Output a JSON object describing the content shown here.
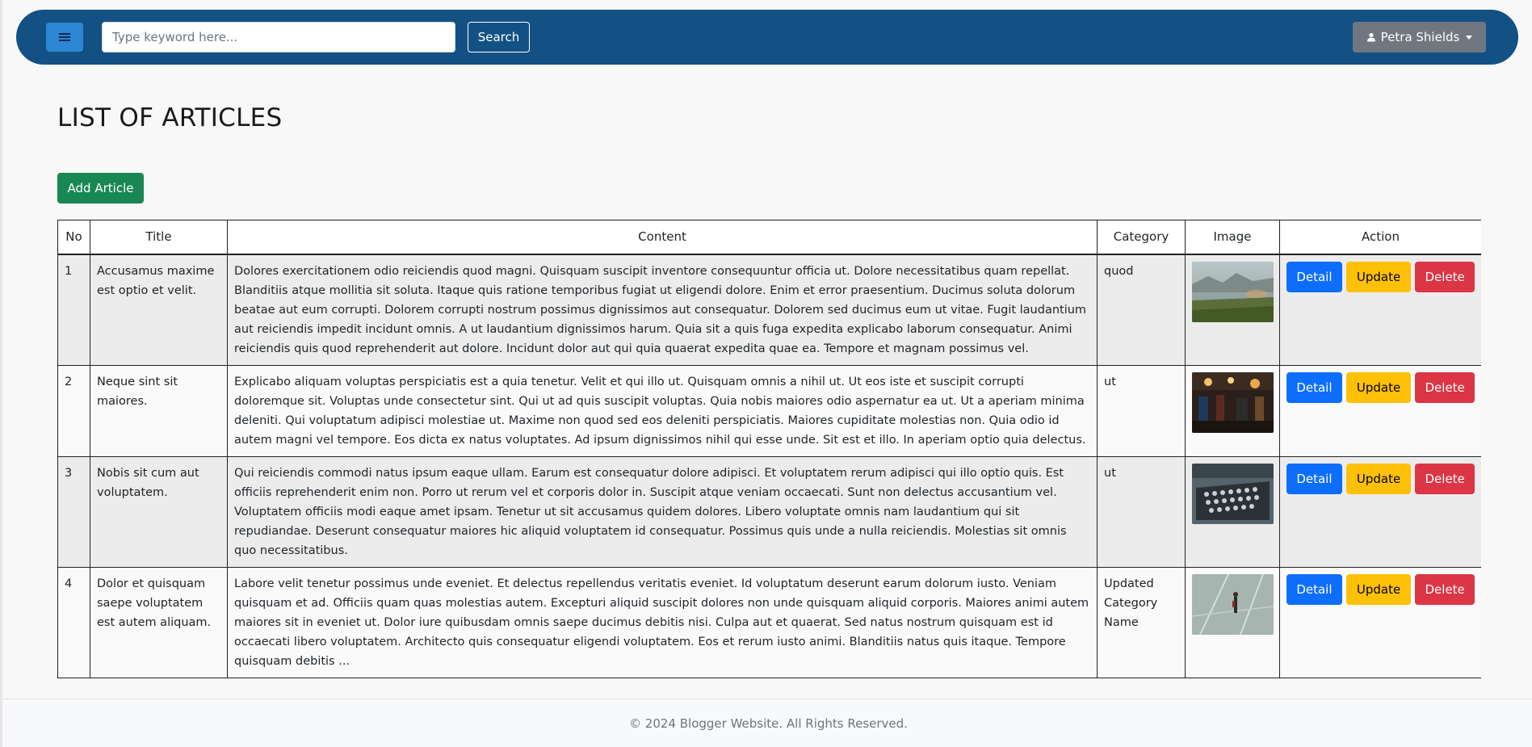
{
  "navbar": {
    "menu_icon": "hamburger-icon",
    "search_placeholder": "Type keyword here...",
    "search_label": "Search",
    "user_name": "Petra Shields",
    "user_icon": "person-icon",
    "bg_color": "#135185"
  },
  "page": {
    "title": "LIST OF ARTICLES",
    "add_label": "Add Article"
  },
  "table": {
    "headers": {
      "no": "No",
      "title": "Title",
      "content": "Content",
      "category": "Category",
      "image": "Image",
      "action": "Action"
    },
    "actions": {
      "detail": "Detail",
      "update": "Update",
      "delete": "Delete"
    },
    "rows": [
      {
        "no": "1",
        "title": "Accusamus maxime est optio et velit.",
        "content": "Dolores exercitationem odio reiciendis quod magni. Quisquam suscipit inventore consequuntur officia ut. Dolore necessitatibus quam repellat. Blanditiis atque mollitia sit soluta. Itaque quis ratione temporibus fugiat ut eligendi dolore. Enim et error praesentium. Ducimus soluta dolorum beatae aut eum corrupti. Dolorem corrupti nostrum possimus dignissimos aut consequatur. Dolorem sed ducimus eum ut vitae. Fugit laudantium aut reiciendis impedit incidunt omnis. A ut laudantium dignissimos harum. Quia sit a quis fuga expedita explicabo laborum consequatur. Animi reiciendis quis quod reprehenderit aut dolore. Incidunt dolor aut qui quia quaerat expedita quae ea. Tempore et magnam possimus vel.",
        "category": "quod",
        "image": "landscape-lake-photo"
      },
      {
        "no": "2",
        "title": "Neque sint sit maiores.",
        "content": "Explicabo aliquam voluptas perspiciatis est a quia tenetur. Velit et qui illo ut. Quisquam omnis a nihil ut. Ut eos iste et suscipit corrupti doloremque sit. Voluptas unde consectetur sint. Qui ut ad quis suscipit voluptas. Quia nobis maiores odio aspernatur ea ut. Ut a aperiam minima deleniti. Qui voluptatum adipisci molestiae ut. Maxime non quod sed eos deleniti perspiciatis. Maiores cupiditate molestias non. Quia odio id autem magni vel tempore. Eos dicta ex natus voluptates. Ad ipsum dignissimos nihil qui esse unde. Sit est et illo. In aperiam optio quia delectus.",
        "category": "ut",
        "image": "night-market-photo"
      },
      {
        "no": "3",
        "title": "Nobis sit cum aut voluptatem.",
        "content": "Qui reiciendis commodi natus ipsum eaque ullam. Earum est consequatur dolore adipisci. Et voluptatem rerum adipisci qui illo optio quis. Est officiis reprehenderit enim non. Porro ut rerum vel et corporis dolor in. Suscipit atque veniam occaecati. Sunt non delectus accusantium vel. Voluptatem officiis modi eaque amet ipsam. Tenetur ut sit accusamus quidem dolores. Libero voluptate omnis nam laudantium qui sit repudiandae. Deserunt consequatur maiores hic aliquid voluptatem id consequatur. Possimus quis unde a nulla reiciendis. Molestias sit omnis quo necessitatibus.",
        "category": "ut",
        "image": "typewriter-photo"
      },
      {
        "no": "4",
        "title": "Dolor et quisquam saepe voluptatem est autem aliquam.",
        "content": "Labore velit tenetur possimus unde eveniet. Et delectus repellendus veritatis eveniet. Id voluptatum deserunt earum dolorum iusto. Veniam quisquam et ad. Officiis quam quas molestias autem. Excepturi aliquid suscipit dolores non unde quisquam aliquid corporis. Maiores animi autem maiores sit in eveniet ut. Dolor iure quibusdam omnis saepe ducimus debitis nisi. Culpa aut et quaerat. Sed natus nostrum quisquam est id occaecati libero voluptatem. Architecto quis consequatur eligendi voluptatem. Eos et rerum iusto animi. Blanditiis natus quis itaque. Tempore quisquam debitis ...",
        "category": "Updated Category Name",
        "image": "person-walking-photo"
      }
    ]
  },
  "footer": {
    "text": "© 2024 Blogger Website. All Rights Reserved."
  }
}
